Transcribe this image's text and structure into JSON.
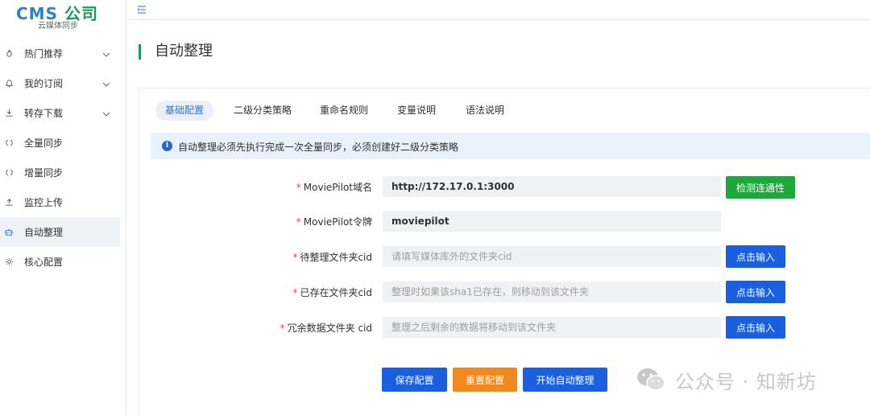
{
  "logo": {
    "brand_latin": "CMS",
    "brand_cn": "公司",
    "subtitle": "云媒体同步"
  },
  "sidebar": {
    "items": [
      {
        "label": "热门推荐",
        "icon": "fire-icon",
        "has_chevron": true,
        "active": false
      },
      {
        "label": "我的订阅",
        "icon": "bell-icon",
        "has_chevron": true,
        "active": false
      },
      {
        "label": "转存下载",
        "icon": "download-icon",
        "has_chevron": true,
        "active": false
      },
      {
        "label": "全量同步",
        "icon": "sync-icon",
        "has_chevron": false,
        "active": false
      },
      {
        "label": "增量同步",
        "icon": "sync-icon",
        "has_chevron": false,
        "active": false
      },
      {
        "label": "监控上传",
        "icon": "upload-icon",
        "has_chevron": false,
        "active": false
      },
      {
        "label": "自动整理",
        "icon": "robot-icon",
        "has_chevron": false,
        "active": true
      },
      {
        "label": "核心配置",
        "icon": "gear-icon",
        "has_chevron": false,
        "active": false
      }
    ]
  },
  "page": {
    "title": "自动整理"
  },
  "tabs": [
    {
      "label": "基础配置",
      "active": true
    },
    {
      "label": "二级分类策略",
      "active": false
    },
    {
      "label": "重命名规则",
      "active": false
    },
    {
      "label": "变量说明",
      "active": false
    },
    {
      "label": "语法说明",
      "active": false
    }
  ],
  "alert": {
    "text": "自动整理必须先执行完成一次全量同步，必须创建好二级分类策略"
  },
  "form": {
    "fields": [
      {
        "label": "MoviePilot域名",
        "value": "http://172.17.0.1:3000",
        "placeholder": "",
        "button": "检测连通性"
      },
      {
        "label": "MoviePilot令牌",
        "value": "moviepilot",
        "placeholder": "",
        "button": ""
      },
      {
        "label": "待整理文件夹cid",
        "value": "",
        "placeholder": "请填写媒体库外的文件夹cid",
        "button": "点击输入"
      },
      {
        "label": "已存在文件夹cid",
        "value": "",
        "placeholder": "整理时如果该sha1已存在，则移动到该文件夹",
        "button": "点击输入"
      },
      {
        "label": "冗余数据文件夹 cid",
        "value": "",
        "placeholder": "整理之后剩余的数据将移动到该文件夹",
        "button": "点击输入"
      }
    ],
    "required_mark": "*"
  },
  "actions": {
    "save": "保存配置",
    "reset": "重置配置",
    "start": "开始自动整理"
  },
  "watermark": {
    "text": "公众号 · 知新坊"
  },
  "colors": {
    "primary_blue": "#1a5fe0",
    "success_green": "#1aaa3a",
    "warning_orange": "#f08a1f",
    "brand_green": "#1a9b5c",
    "brand_blue": "#2f7fd1"
  }
}
